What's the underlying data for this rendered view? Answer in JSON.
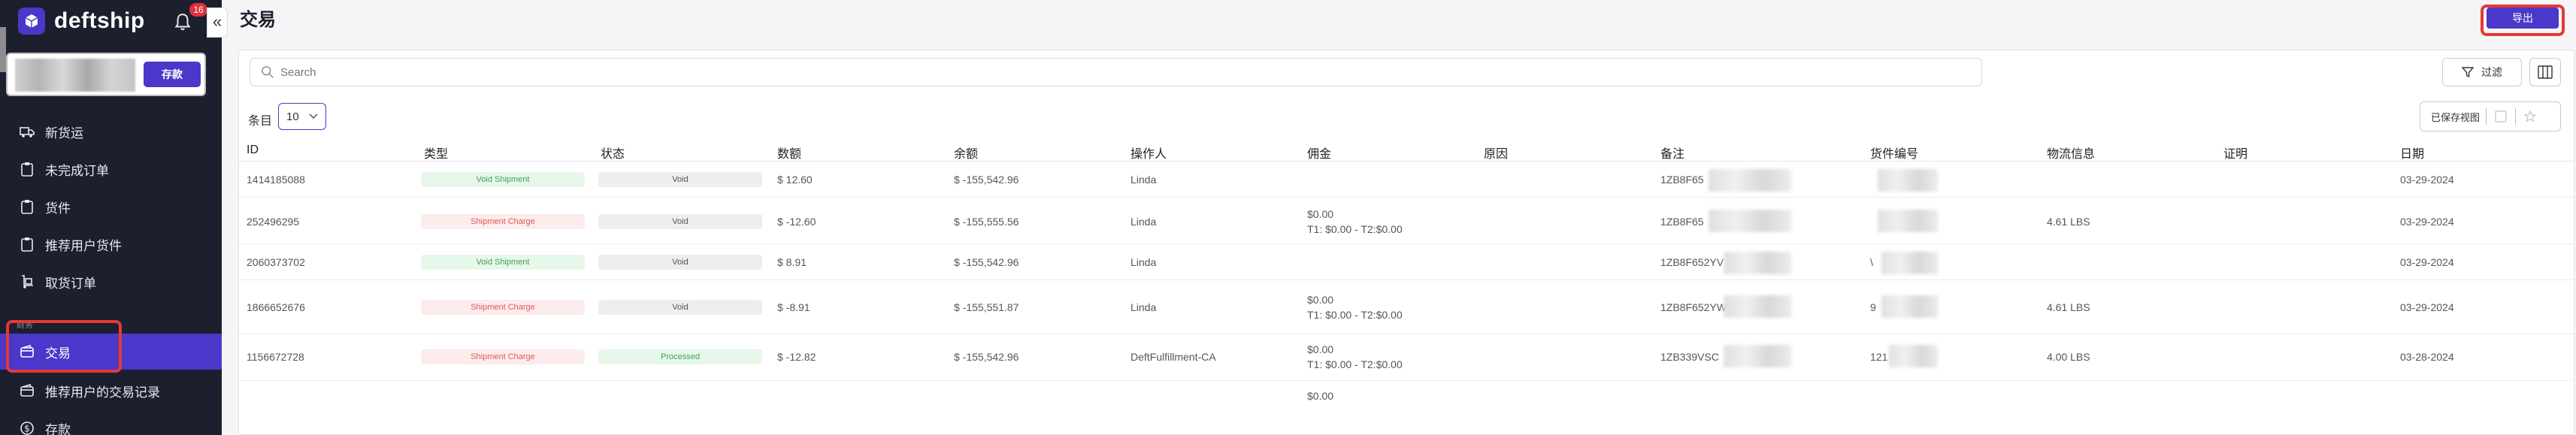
{
  "sidebar": {
    "brand": "deftship",
    "notifications": "16",
    "collapse_glyph": "«",
    "deposit_label": "存款",
    "items": [
      {
        "label": "新货运",
        "icon": "truck-icon"
      },
      {
        "label": "未完成订单",
        "icon": "clipboard-icon"
      },
      {
        "label": "货件",
        "icon": "clipboard-icon"
      },
      {
        "label": "推荐用户货件",
        "icon": "clipboard-icon"
      },
      {
        "label": "取货订单",
        "icon": "dolly-icon"
      }
    ],
    "section_label": "财务",
    "active_item": {
      "label": "交易",
      "icon": "wallet-icon"
    },
    "lower_items": [
      {
        "label": "推荐用户的交易记录",
        "icon": "wallet-icon"
      },
      {
        "label": "存款",
        "icon": "dollar-icon"
      }
    ]
  },
  "main": {
    "title": "交易",
    "export_label": "导出",
    "search_placeholder": "Search",
    "filter_label": "过滤",
    "entries_label": "条目",
    "entries_value": "10",
    "saved_views_label": "已保存视图",
    "columns": [
      "ID",
      "类型",
      "状态",
      "数额",
      "余额",
      "操作人",
      "佣金",
      "原因",
      "备注",
      "货件编号",
      "物流信息",
      "证明",
      "日期"
    ],
    "rows": [
      {
        "id": "1414185088",
        "type": "Void Shipment",
        "type_color": "green",
        "status": "Void",
        "status_color": "grey",
        "amount": "$ 12.60",
        "balance": "$ -155,542.96",
        "operator": "Linda",
        "commission_1": "",
        "commission_2": "",
        "note": "1ZB8F65",
        "shipment": "",
        "logistics": "",
        "date": "03-29-2024"
      },
      {
        "id": "252496295",
        "type": "Shipment Charge",
        "type_color": "red",
        "status": "Void",
        "status_color": "grey",
        "amount": "$ -12.60",
        "balance": "$ -155,555.56",
        "operator": "Linda",
        "commission_1": "$0.00",
        "commission_2": "T1: $0.00 - T2:$0.00",
        "note": "1ZB8F65",
        "shipment": "",
        "logistics": "4.61 LBS",
        "date": "03-29-2024"
      },
      {
        "id": "2060373702",
        "type": "Void Shipment",
        "type_color": "green",
        "status": "Void",
        "status_color": "grey",
        "amount": "$ 8.91",
        "balance": "$ -155,542.96",
        "operator": "Linda",
        "commission_1": "",
        "commission_2": "",
        "note": "1ZB8F652YV",
        "shipment": "\\",
        "logistics": "",
        "date": "03-29-2024"
      },
      {
        "id": "1866652676",
        "type": "Shipment Charge",
        "type_color": "red",
        "status": "Void",
        "status_color": "grey",
        "amount": "$ -8.91",
        "balance": "$ -155,551.87",
        "operator": "Linda",
        "commission_1": "$0.00",
        "commission_2": "T1: $0.00 - T2:$0.00",
        "note": "1ZB8F652YW",
        "shipment": "9",
        "logistics": "4.61 LBS",
        "date": "03-29-2024"
      },
      {
        "id": "1156672728",
        "type": "Shipment Charge",
        "type_color": "red",
        "status": "Processed",
        "status_color": "green",
        "amount": "$ -12.82",
        "balance": "$ -155,542.96",
        "operator": "DeftFulfillment-CA",
        "commission_1": "$0.00",
        "commission_2": "T1: $0.00 - T2:$0.00",
        "note": "1ZB339VSC",
        "shipment": "121",
        "logistics": "4.00 LBS",
        "date": "03-28-2024"
      }
    ],
    "partial_row_text": "$0.00"
  }
}
